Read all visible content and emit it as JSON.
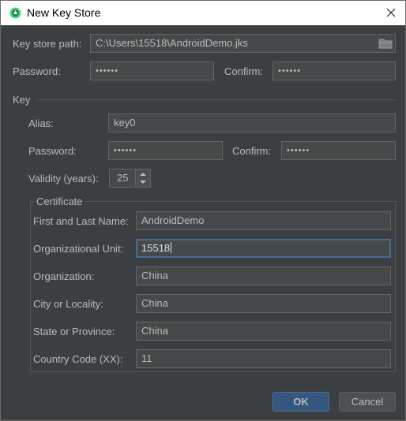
{
  "window": {
    "title": "New Key Store",
    "close_glyph": "✕"
  },
  "keystore": {
    "path_label": "Key store path:",
    "path_value": "C:\\Users\\15518\\AndroidDemo.jks",
    "browse_icon": "folder-icon",
    "password_label": "Password:",
    "password_value": "••••••",
    "confirm_label": "Confirm:",
    "confirm_value": "••••••"
  },
  "key": {
    "section_label": "Key",
    "alias_label": "Alias:",
    "alias_value": "key0",
    "password_label": "Password:",
    "password_value": "••••••",
    "confirm_label": "Confirm:",
    "confirm_value": "••••••",
    "validity_label": "Validity (years):",
    "validity_value": "25"
  },
  "certificate": {
    "group_label": "Certificate",
    "first_last_name_label": "First and Last Name:",
    "first_last_name_value": "AndroidDemo",
    "org_unit_label": "Organizational Unit:",
    "org_unit_value": "15518",
    "organization_label": "Organization:",
    "organization_value": "China",
    "city_label": "City or Locality:",
    "city_value": "China",
    "state_label": "State or Province:",
    "state_value": "China",
    "country_label": "Country Code (XX):",
    "country_value": "11"
  },
  "buttons": {
    "ok": "OK",
    "cancel": "Cancel"
  },
  "colors": {
    "background": "#3c3f41",
    "field_bg": "#45494a",
    "focus_border": "#466d94",
    "ok_button": "#365880"
  }
}
